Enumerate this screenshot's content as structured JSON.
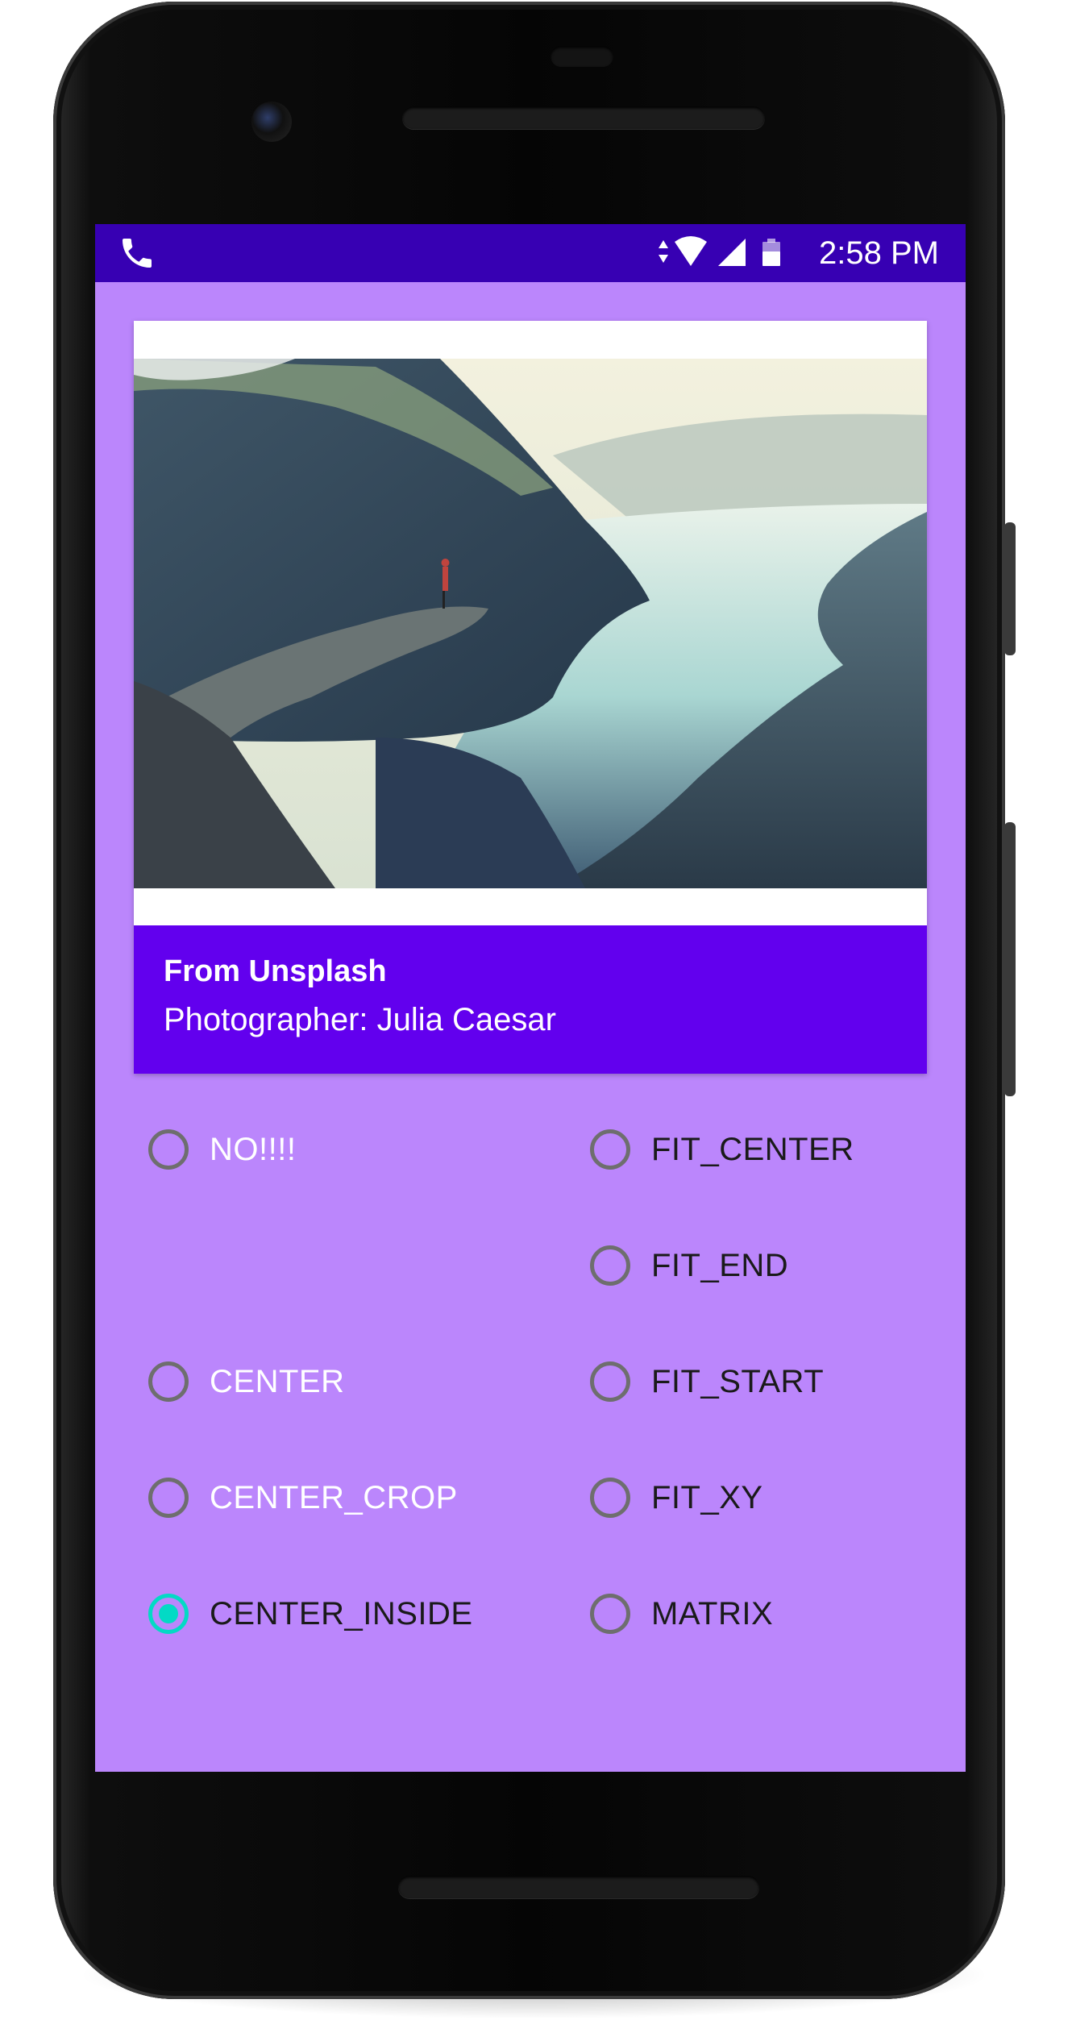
{
  "status_bar": {
    "time": "2:58 PM",
    "icons": [
      "phone-icon",
      "data-arrows-icon",
      "wifi-icon",
      "signal-icon",
      "battery-icon"
    ]
  },
  "card": {
    "image": "mountain-fjord-photo",
    "title": "From Unsplash",
    "subtitle": "Photographer: Julia Caesar"
  },
  "scale_types": {
    "no": "NO!!!!",
    "center": "CENTER",
    "center_crop": "CENTER_CROP",
    "center_inside": "CENTER_INSIDE",
    "fit_center": "FIT_CENTER",
    "fit_end": "FIT_END",
    "fit_start": "FIT_START",
    "fit_xy": "FIT_XY",
    "matrix": "MATRIX",
    "selected": "CENTER_INSIDE"
  },
  "colors": {
    "status_bar": "#3700b3",
    "background": "#bb86fc",
    "caption": "#6200ee",
    "radio_selected": "#03dac5"
  }
}
